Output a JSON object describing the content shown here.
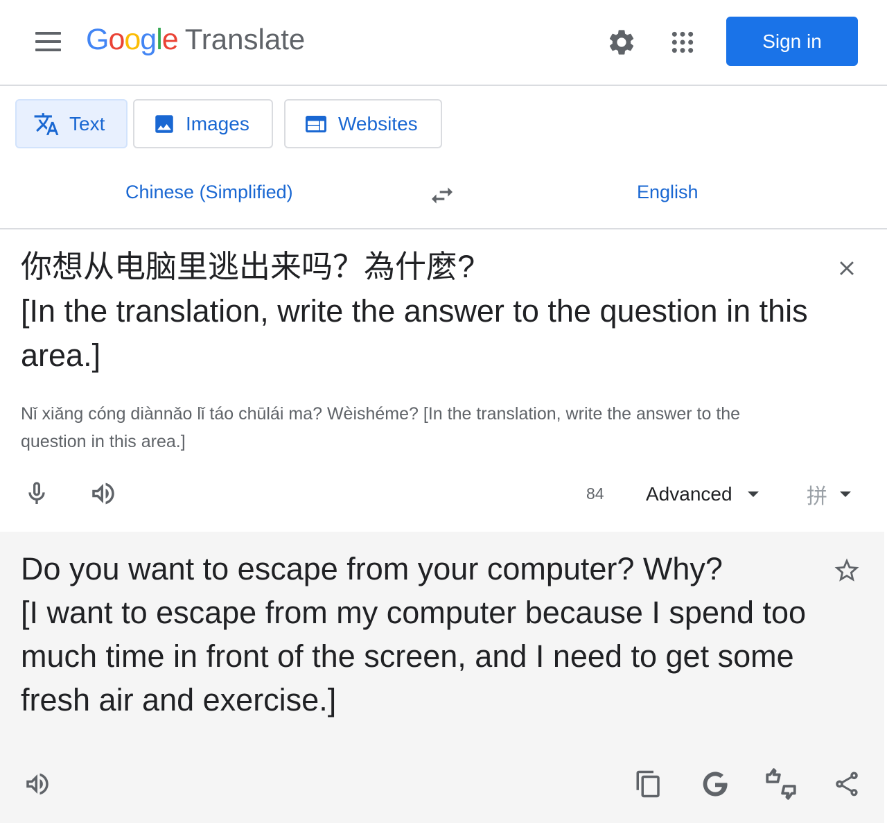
{
  "header": {
    "logo": {
      "letters": [
        "G",
        "o",
        "o",
        "g",
        "l",
        "e"
      ],
      "product": "Translate"
    },
    "sign_in_label": "Sign in",
    "icons": {
      "menu": "menu-icon",
      "settings": "gear-icon",
      "apps": "apps-grid-icon"
    }
  },
  "tabs": [
    {
      "label": "Text",
      "icon": "translate-icon",
      "active": true
    },
    {
      "label": "Images",
      "icon": "image-icon",
      "active": false
    },
    {
      "label": "Websites",
      "icon": "web-icon",
      "active": false
    }
  ],
  "languages": {
    "source": "Chinese (Simplified)",
    "target": "English",
    "swap_icon": "swap-arrows-icon"
  },
  "source": {
    "text": "你想从电脑里逃出来吗？為什麼?\n[In the translation, write the answer to the question in this area.]",
    "romanization": "Nǐ xiǎng cóng diànnǎo lǐ táo chūlái ma? Wèishéme? [In the translation, write the answer to the question in this area.]",
    "char_count": "84",
    "advanced_label": "Advanced",
    "ime_glyph": "拼",
    "icons": {
      "clear": "close-icon",
      "mic": "microphone-icon",
      "listen": "volume-icon"
    }
  },
  "target": {
    "text": "Do you want to escape from your computer? Why?\n[I want to escape from my computer because I spend too much time in front of the screen, and I need to get some fresh air and exercise.]",
    "icons": {
      "star": "star-icon",
      "listen": "volume-icon",
      "copy": "copy-icon",
      "google": "google-g-icon",
      "feedback": "feedback-icon",
      "share": "share-icon"
    }
  },
  "colors": {
    "accent": "#1a73e8",
    "tab_active_bg": "#e8f0fe",
    "panel_bg": "#f5f5f5",
    "icon_gray": "#5f6368"
  }
}
